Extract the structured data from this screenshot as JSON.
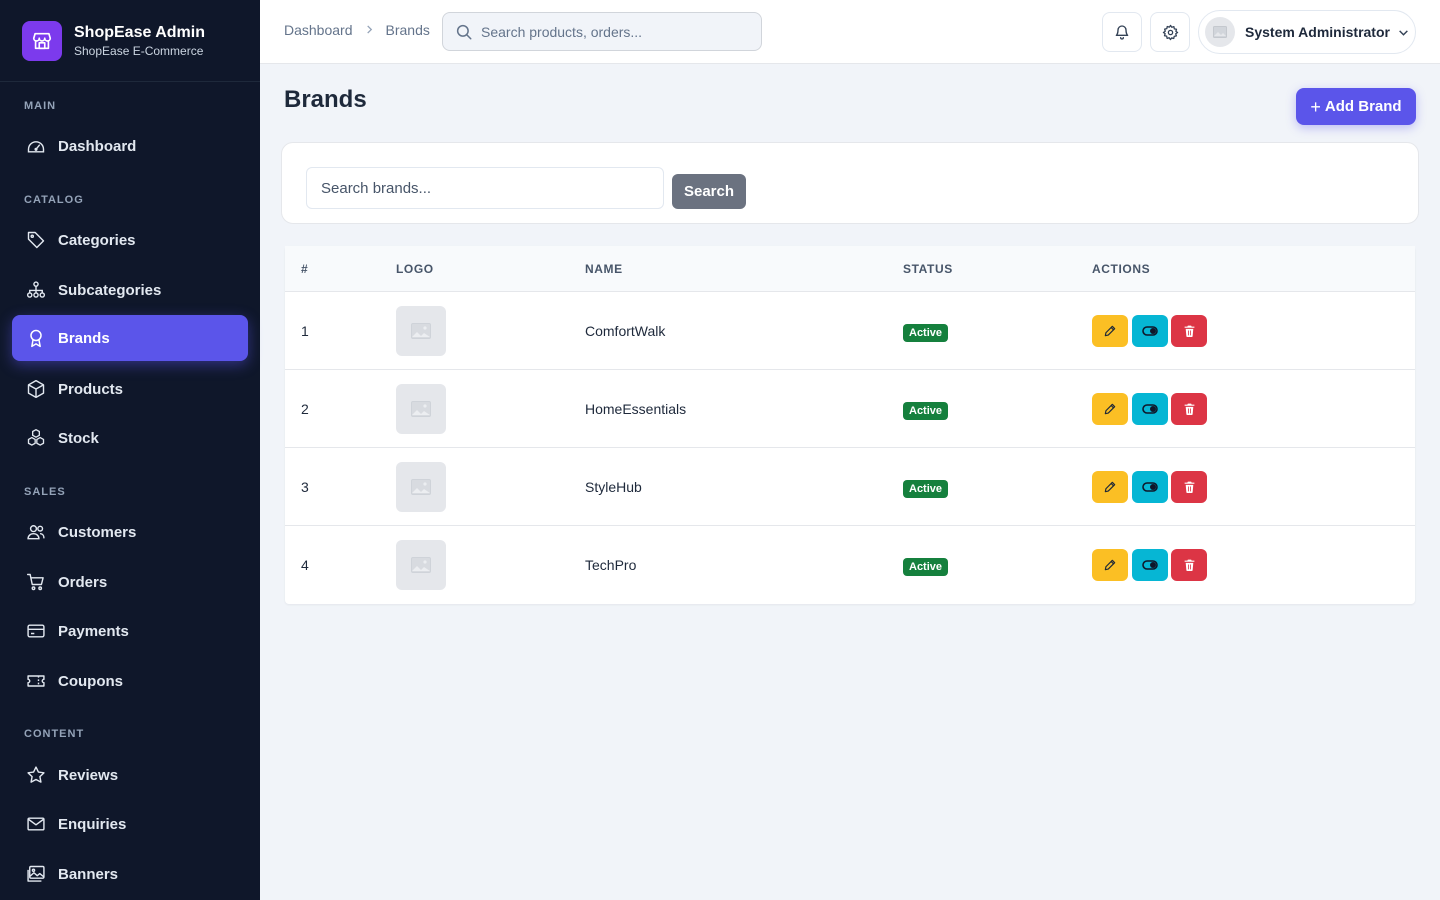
{
  "app": {
    "title": "ShopEase Admin",
    "subtitle": "ShopEase E-Commerce"
  },
  "sidebar": {
    "sections": [
      {
        "label": "MAIN"
      },
      {
        "label": "CATALOG"
      },
      {
        "label": "SALES"
      },
      {
        "label": "CONTENT"
      }
    ],
    "items": [
      {
        "label": "Dashboard",
        "icon": "dashboard-icon"
      },
      {
        "label": "Categories",
        "icon": "tag-icon"
      },
      {
        "label": "Subcategories",
        "icon": "hierarchy-icon"
      },
      {
        "label": "Brands",
        "icon": "award-icon",
        "active": true
      },
      {
        "label": "Products",
        "icon": "box-icon"
      },
      {
        "label": "Stock",
        "icon": "boxes-icon"
      },
      {
        "label": "Customers",
        "icon": "users-icon"
      },
      {
        "label": "Orders",
        "icon": "cart-icon"
      },
      {
        "label": "Payments",
        "icon": "credit-card-icon"
      },
      {
        "label": "Coupons",
        "icon": "ticket-icon"
      },
      {
        "label": "Reviews",
        "icon": "star-icon"
      },
      {
        "label": "Enquiries",
        "icon": "envelope-icon"
      },
      {
        "label": "Banners",
        "icon": "images-icon"
      }
    ]
  },
  "topbar": {
    "breadcrumb": [
      "Dashboard",
      "Brands"
    ],
    "search_placeholder": "Search products, orders...",
    "user_name": "System Administrator"
  },
  "page": {
    "title": "Brands",
    "add_button": "Add Brand",
    "filter_placeholder": "Search brands...",
    "filter_button": "Search"
  },
  "table": {
    "headers": [
      "#",
      "LOGO",
      "NAME",
      "STATUS",
      "ACTIONS"
    ],
    "rows": [
      {
        "id": "1",
        "name": "ComfortWalk",
        "status": "Active"
      },
      {
        "id": "2",
        "name": "HomeEssentials",
        "status": "Active"
      },
      {
        "id": "3",
        "name": "StyleHub",
        "status": "Active"
      },
      {
        "id": "4",
        "name": "TechPro",
        "status": "Active"
      }
    ]
  },
  "colors": {
    "sidebar_bg": "#0f172a",
    "accent": "#5b55ea",
    "brand_logo": "#7c3aed",
    "status_active": "#15803d",
    "edit": "#fbbf24",
    "toggle": "#06b6d4",
    "delete": "#dc3545"
  }
}
